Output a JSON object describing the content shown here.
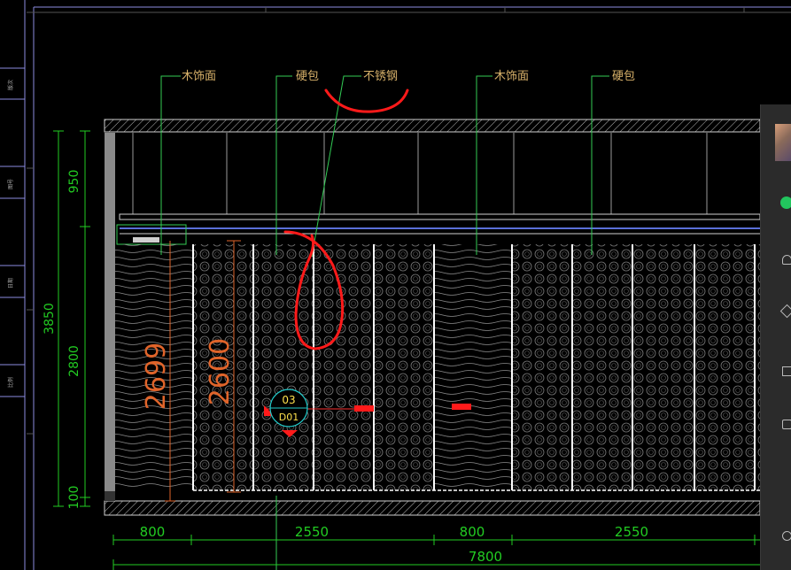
{
  "drawing": {
    "labels": {
      "wood_finish": "木饰面",
      "hard_pack": "硬包",
      "stainless_steel": "不锈钢"
    },
    "left_titles": [
      "版次",
      "图号",
      "日期",
      "比例"
    ],
    "dims_vertical": {
      "total": "3850",
      "top": "950",
      "mid": "2800",
      "bottom": "100",
      "panel_a": "2699",
      "panel_b": "2600"
    },
    "dims_horizontal": {
      "seg1": "800",
      "seg2": "2550",
      "seg3": "800",
      "seg4": "2550",
      "total": "7800"
    },
    "section_marker": {
      "top": "03",
      "bottom": "D01"
    }
  },
  "colors": {
    "background": "#000000",
    "dimension": "#22cc22",
    "annotation": "#d9b26a",
    "panel_dim": "#e0642a",
    "markup": "#ff1a1a",
    "marker_circle": "#22cccc",
    "marker_text": "#ffe14d",
    "ceiling_line": "#5a6fd8"
  },
  "side_panel_icons": [
    "avatar-thumbnail",
    "chat-icon",
    "user-icon",
    "cube-icon",
    "window-icon",
    "box-icon",
    "gear-icon"
  ]
}
